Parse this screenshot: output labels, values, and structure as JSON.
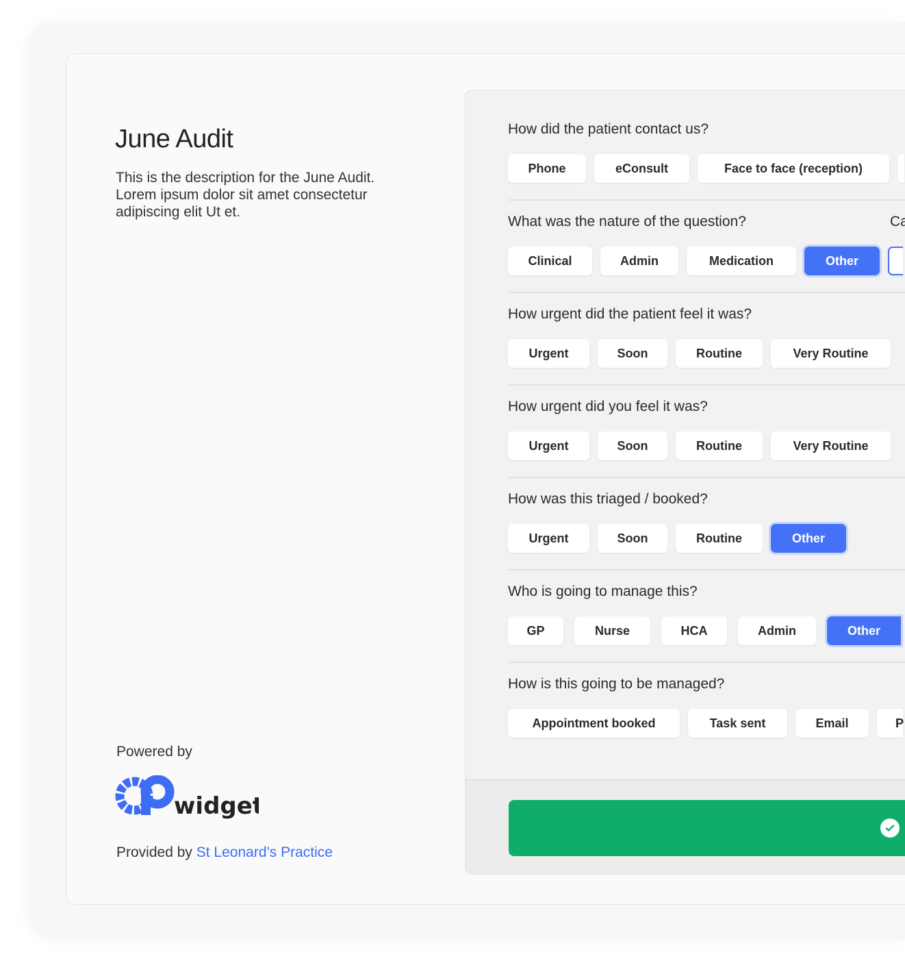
{
  "audit": {
    "title": "June Audit",
    "description": "This is the description for the June Audit. Lorem ipsum dolor sit amet consectetur adipiscing elit Ut et."
  },
  "powered_by": "Powered by",
  "logo": {
    "text": "widget",
    "mark": "GP"
  },
  "provided_by": {
    "label": "Provided by",
    "practice": "St Leonard’s Practice"
  },
  "colors": {
    "accent": "#4472f7",
    "submit": "#10ad6a"
  },
  "questions": [
    {
      "title": "How did the patient contact us?",
      "options": [
        "Phone",
        "eConsult",
        "Face to face (reception)",
        ""
      ],
      "selected": null
    },
    {
      "title": "What was the nature of the question?",
      "options": [
        "Clinical",
        "Admin",
        "Medication",
        "Other"
      ],
      "selected": "Other"
    },
    {
      "title": "How urgent did the patient feel it was?",
      "options": [
        "Urgent",
        "Soon",
        "Routine",
        "Very Routine"
      ],
      "selected": null
    },
    {
      "title": "How urgent did you feel it was?",
      "options": [
        "Urgent",
        "Soon",
        "Routine",
        "Very Routine"
      ],
      "selected": null
    },
    {
      "title": "How was this triaged / booked?",
      "options": [
        "Urgent",
        "Soon",
        "Routine",
        "Other"
      ],
      "selected": "Other"
    },
    {
      "title": "Who is going to manage this?",
      "options": [
        "GP",
        "Nurse",
        "HCA",
        "Admin",
        "Other"
      ],
      "selected": "Other"
    },
    {
      "title": "How is this going to be managed?",
      "options": [
        "Appointment booked",
        "Task sent",
        "Email",
        "P"
      ],
      "selected": null
    }
  ],
  "side_question": {
    "title": "Ca"
  },
  "submit": {
    "icon": "check-circle-icon"
  }
}
